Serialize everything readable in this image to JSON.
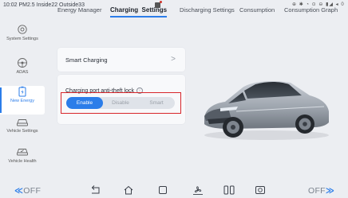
{
  "status": {
    "left_text": "10:02 PM2.5 Inside22 Outside33",
    "right_text": "⊕ ✱ ◔ ⊙ ⊖ ▮◢ ◂ 0"
  },
  "sidebar": {
    "items": [
      {
        "label": "System Settings",
        "icon": "gear-icon"
      },
      {
        "label": "ADAS",
        "icon": "steering-wheel-icon"
      },
      {
        "label": "New Energy",
        "icon": "battery-icon",
        "active": true
      },
      {
        "label": "Vehicle Settings",
        "icon": "car-icon"
      },
      {
        "label": "Vehicle Health",
        "icon": "car-health-icon"
      }
    ]
  },
  "tabs": [
    {
      "label": "Energy Manager"
    },
    {
      "label": "Charging  Settings",
      "active": true
    },
    {
      "label": "Discharging Settings"
    },
    {
      "label": "Consumption"
    },
    {
      "label": "Consumption Graph"
    }
  ],
  "smart_charging": {
    "label": "Smart Charging",
    "chevron": ">"
  },
  "antitheft": {
    "label": "Charging port anti-theft lock",
    "info_glyph": "i",
    "options": [
      "Enable",
      "Disable",
      "Smart"
    ],
    "selected": "Enable"
  },
  "bottom": {
    "left_climate": "OFF",
    "right_climate": "OFF",
    "nav_icons": [
      "back-icon",
      "home-icon",
      "recent-apps-icon",
      "fan-icon",
      "seat-icon",
      "camera-icon"
    ]
  },
  "colors": {
    "accent": "#2b7de9",
    "highlight": "#d7252a",
    "background": "#eceef2"
  }
}
